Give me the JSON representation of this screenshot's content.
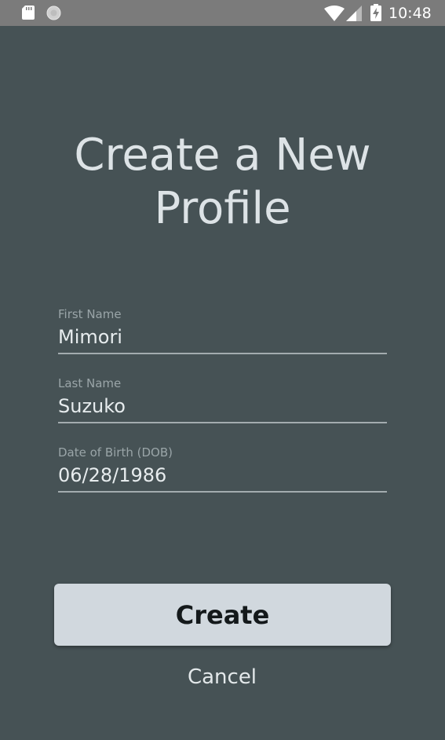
{
  "status_bar": {
    "time": "10:48",
    "icons": [
      "sd-card-icon",
      "circle-icon",
      "wifi-icon",
      "signal-icon",
      "battery-charging-icon"
    ]
  },
  "page": {
    "title_line1": "Create a New",
    "title_line2": "Profile"
  },
  "form": {
    "first_name": {
      "label": "First Name",
      "value": "Mimori"
    },
    "last_name": {
      "label": "Last Name",
      "value": "Suzuko"
    },
    "dob": {
      "label": "Date of Birth (DOB)",
      "value": "06/28/1986"
    }
  },
  "actions": {
    "create_label": "Create",
    "cancel_label": "Cancel"
  },
  "colors": {
    "background": "#465255",
    "status_bar": "#7b7b7b",
    "button": "#d1d8de"
  }
}
